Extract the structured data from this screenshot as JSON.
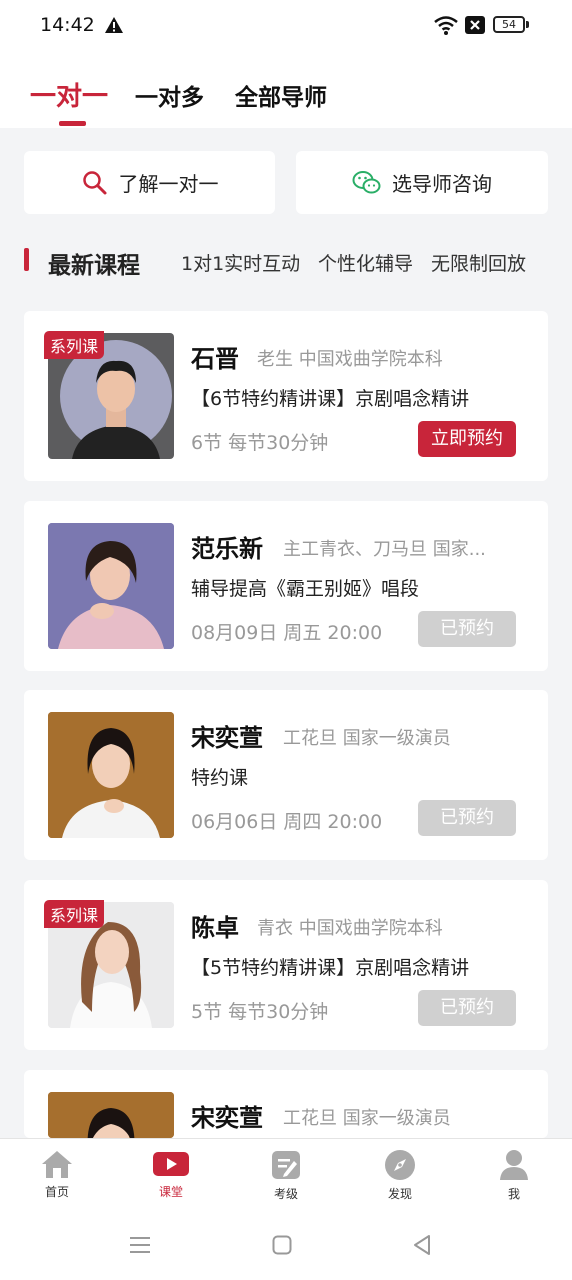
{
  "status_bar": {
    "time": "14:42",
    "battery": "54"
  },
  "tabs": [
    {
      "label": "一对一",
      "active": true
    },
    {
      "label": "一对多",
      "active": false
    },
    {
      "label": "全部导师",
      "active": false
    }
  ],
  "entries": [
    {
      "label": "了解一对一",
      "icon": "search-icon"
    },
    {
      "label": "选导师咨询",
      "icon": "wechat-icon"
    }
  ],
  "section": {
    "title": "最新课程",
    "tags": [
      "1对1实时互动",
      "个性化辅导",
      "无限制回放"
    ]
  },
  "courses": [
    {
      "badge": "系列课",
      "name": "石晋",
      "meta": "老生 中国戏曲学院本科",
      "title": "【6节特约精讲课】京剧唱念精讲",
      "info": "6节 每节30分钟",
      "button": "立即预约",
      "booked": false
    },
    {
      "badge": "",
      "name": "范乐新",
      "meta": "主工青衣、刀马旦 国家...",
      "title": "辅导提高《霸王别姬》唱段",
      "info": "08月09日 周五 20:00",
      "button": "已预约",
      "booked": true
    },
    {
      "badge": "",
      "name": "宋奕萱",
      "meta": "工花旦 国家一级演员",
      "title": "特约课",
      "info": "06月06日 周四 20:00",
      "button": "已预约",
      "booked": true
    },
    {
      "badge": "系列课",
      "name": "陈卓",
      "meta": "青衣 中国戏曲学院本科",
      "title": "【5节特约精讲课】京剧唱念精讲",
      "info": "5节 每节30分钟",
      "button": "已预约",
      "booked": true
    },
    {
      "badge": "",
      "name": "宋奕萱",
      "meta": "工花旦 国家一级演员",
      "title": "",
      "info": "",
      "button": "",
      "booked": true
    }
  ],
  "bottom_nav": [
    {
      "label": "首页",
      "icon": "home-icon",
      "active": false
    },
    {
      "label": "课堂",
      "icon": "video-class-icon",
      "active": true
    },
    {
      "label": "考级",
      "icon": "exam-edit-icon",
      "active": false
    },
    {
      "label": "发现",
      "icon": "compass-icon",
      "active": false
    },
    {
      "label": "我",
      "icon": "user-icon",
      "active": false
    }
  ],
  "colors": {
    "accent": "#c8253a",
    "muted": "#999999",
    "disabled_button": "#d0d0d0",
    "wechat_green": "#2aae67"
  }
}
